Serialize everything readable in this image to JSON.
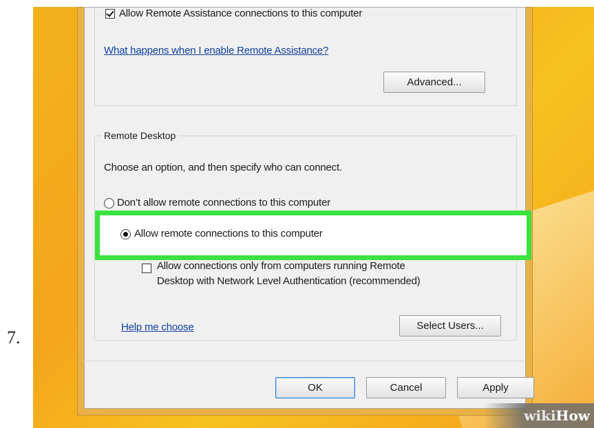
{
  "step": {
    "number": "7."
  },
  "remote_assistance": {
    "checkbox_label": "Allow Remote Assistance connections to this computer",
    "checkbox_checked": true,
    "help_link": "What happens when I enable Remote Assistance?",
    "advanced_button": "Advanced..."
  },
  "remote_desktop": {
    "group_title": "Remote Desktop",
    "instruction": "Choose an option, and then specify who can connect.",
    "options": [
      {
        "label": "Don’t allow remote connections to this computer",
        "selected": false
      },
      {
        "label": "Allow remote connections to this computer",
        "selected": true
      }
    ],
    "nla_checkbox_line1": "Allow connections only from computers running Remote",
    "nla_checkbox_line2": "Desktop with Network Level Authentication (recommended)",
    "nla_checked": false,
    "help_link": "Help me choose",
    "select_users_button": "Select Users..."
  },
  "footer": {
    "ok_button": "OK",
    "cancel_button": "Cancel",
    "apply_button": "Apply"
  },
  "watermark": {
    "wiki": "wiki",
    "how": "How"
  },
  "colors": {
    "highlight": "#3ce23f",
    "link": "#0f3f9f",
    "background": "#f4a51b"
  }
}
